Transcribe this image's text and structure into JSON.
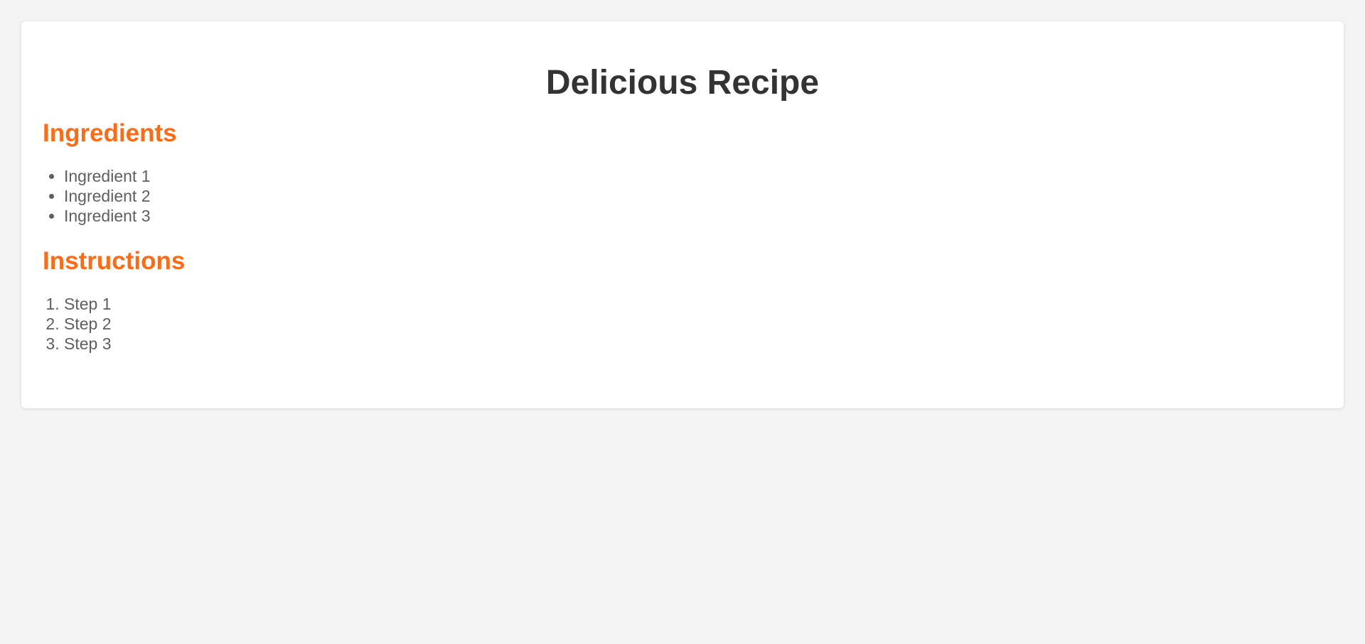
{
  "recipe": {
    "title": "Delicious Recipe",
    "ingredients": {
      "heading": "Ingredients",
      "items": [
        "Ingredient 1",
        "Ingredient 2",
        "Ingredient 3"
      ]
    },
    "instructions": {
      "heading": "Instructions",
      "steps": [
        "Step 1",
        "Step 2",
        "Step 3"
      ]
    }
  },
  "colors": {
    "background": "#f4f4f4",
    "card": "#ffffff",
    "title": "#333333",
    "heading_accent": "#ff6a13",
    "body_text": "#5f5f5f"
  }
}
